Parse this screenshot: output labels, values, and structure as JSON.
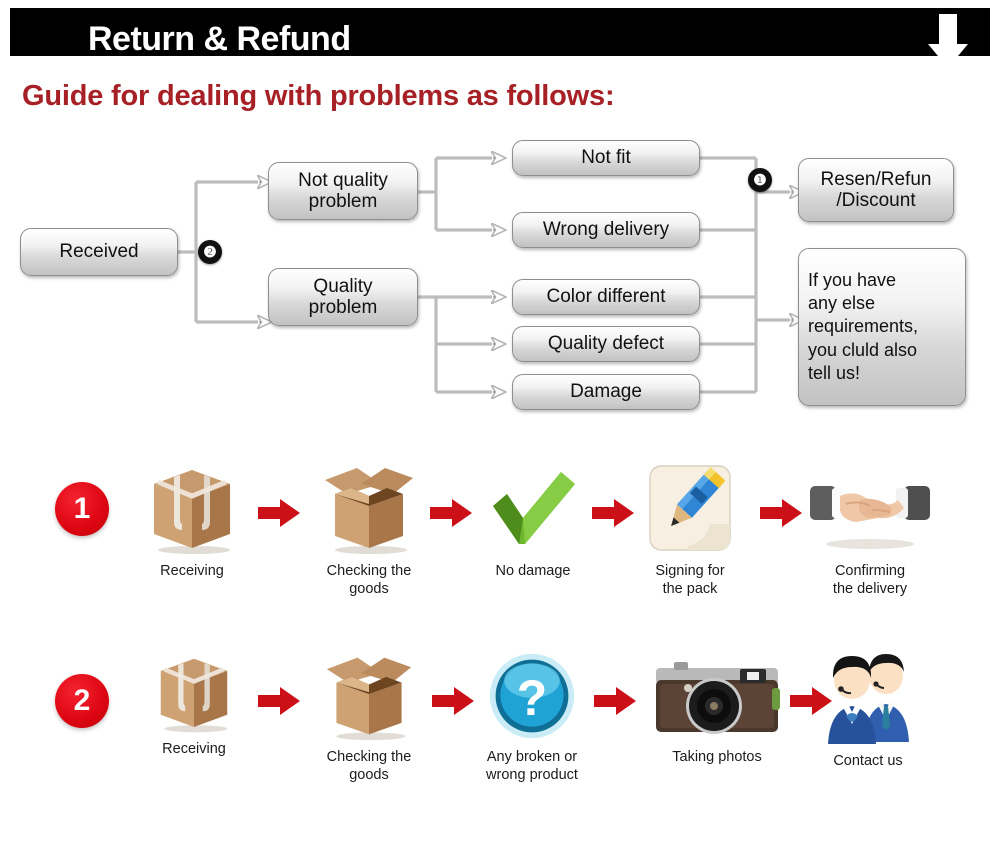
{
  "header": {
    "title": "Return & Refund",
    "arrow_icon": "down-arrow-icon",
    "background_color": "#000000",
    "text_color": "#FFFFFF"
  },
  "guide": {
    "title": "Guide for dealing with problems as follows:",
    "color": "#A62025"
  },
  "flowchart": {
    "nodes": {
      "received": "Received",
      "not_quality": "Not quality\nproblem",
      "quality": "Quality\nproblem",
      "not_fit": "Not fit",
      "wrong_delivery": "Wrong delivery",
      "color_different": "Color different",
      "quality_defect": "Quality defect",
      "damage": "Damage",
      "resend": "Resen/Refun\n/Discount",
      "more": "If you have\nany else\nrequirements,\nyou cluld also\ntell us!"
    },
    "badges": {
      "branch_three": "❷",
      "branch_two": "❶"
    },
    "connector_color": "#BDBDBD"
  },
  "process": {
    "rows": [
      {
        "badge": "1",
        "steps": [
          {
            "icon": "closed-box-icon",
            "label": "Receiving"
          },
          {
            "icon": "open-box-icon",
            "label": "Checking the\ngoods"
          },
          {
            "icon": "green-check-icon",
            "label": "No damage"
          },
          {
            "icon": "pencil-sign-icon",
            "label": "Signing for\nthe pack"
          },
          {
            "icon": "handshake-icon",
            "label": "Confirming\nthe delivery"
          }
        ]
      },
      {
        "badge": "2",
        "steps": [
          {
            "icon": "closed-box-icon",
            "label": "Receiving"
          },
          {
            "icon": "open-box-icon",
            "label": "Checking the\ngoods"
          },
          {
            "icon": "question-mark-icon",
            "label": "Any broken or\nwrong product"
          },
          {
            "icon": "camera-icon",
            "label": "Taking photos"
          },
          {
            "icon": "support-people-icon",
            "label": "Contact us"
          }
        ]
      }
    ],
    "arrow_icon": "red-right-arrow-icon",
    "arrow_color": "#CC1018",
    "badge_color": "#DD0713"
  }
}
